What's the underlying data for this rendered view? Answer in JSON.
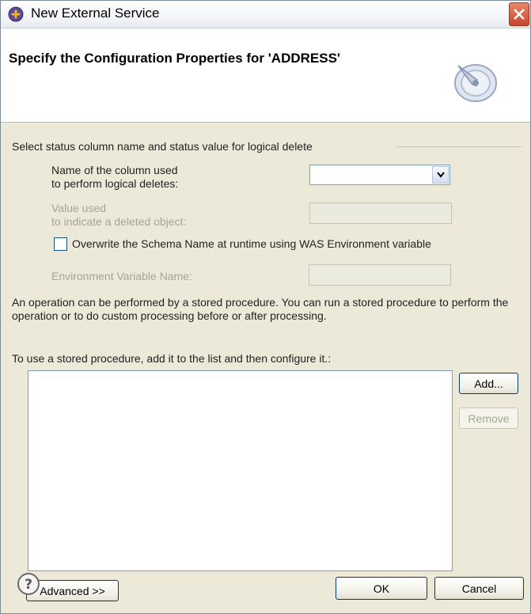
{
  "window": {
    "title": "New External Service",
    "icon": "plug-icon",
    "close_icon": "close-icon"
  },
  "banner": {
    "heading": "Specify the Configuration Properties for 'ADDRESS'",
    "icon": "wizard-dial-icon"
  },
  "logical_delete": {
    "group_label": "Select status column name and status value for logical delete",
    "column_label_line1": "Name of the column used",
    "column_label_line2": "to perform logical deletes:",
    "column_value": "",
    "value_label_line1": "Value used",
    "value_label_line2": "to indicate a deleted object:",
    "value_value": ""
  },
  "schema": {
    "checkbox_label": "Overwrite the Schema Name at runtime using WAS Environment variable",
    "checked": false,
    "env_label": "Environment Variable Name:",
    "env_value": ""
  },
  "stored_procedure": {
    "description": "An operation can be performed by a stored procedure. You can run a stored procedure to perform the operation or to do custom processing before or after processing.",
    "list_prompt": "To use a stored procedure, add it to the list and then configure it.:",
    "items": [],
    "add_label": "Add...",
    "remove_label": "Remove"
  },
  "footer": {
    "advanced_label": "Advanced >>",
    "help_icon": "help-icon",
    "ok_label": "OK",
    "cancel_label": "Cancel"
  }
}
